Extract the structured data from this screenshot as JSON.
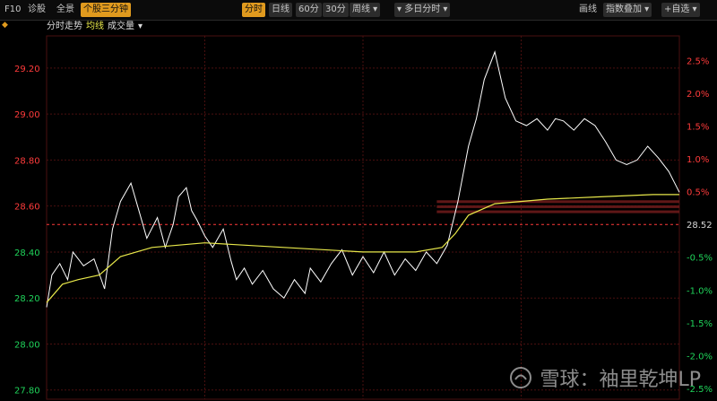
{
  "toolbar": {
    "left_items": [
      "F10",
      "诊股",
      "全景",
      "个股三分钟"
    ],
    "period_tabs": [
      "分时",
      "日线",
      "60分",
      "30分",
      "周线 ▾"
    ],
    "multiday": "▾ 多日分时 ▾",
    "right_items": [
      "画线",
      "指数叠加 ▾",
      "+自选 ▾"
    ]
  },
  "subbar": {
    "label1": "分时走势",
    "label2": "均线",
    "label3": "成交量",
    "caret": "▾"
  },
  "colors": {
    "price_line": "#ffffff",
    "avg_line": "#e8e84a",
    "up": "#ff3b3b",
    "down": "#1fd35a",
    "ref": "#d8d8d8",
    "grid": "#4a0f0f",
    "accent": "#e09a1e"
  },
  "chart_data": {
    "type": "line",
    "title": "",
    "xlabel": "",
    "ylabel": "",
    "ylim": [
      27.76,
      29.34
    ],
    "prev_close": 28.52,
    "left_ticks": [
      "29.20",
      "29.00",
      "28.80",
      "28.60",
      "28.40",
      "28.20",
      "28.00",
      "27.80"
    ],
    "right_ticks": [
      "2.5%",
      "2.0%",
      "1.5%",
      "1.0%",
      "0.5%",
      "-0.5%",
      "-1.0%",
      "-1.5%",
      "-2.0%",
      "-2.5%"
    ],
    "prev_close_label": "28.52",
    "grid": true,
    "series": [
      {
        "x": [
          0,
          2,
          5,
          8,
          10,
          14,
          18,
          22,
          25,
          28,
          32,
          35,
          38,
          42,
          45,
          48,
          50,
          53,
          55,
          57,
          60,
          63,
          65,
          67,
          70,
          72,
          75,
          78,
          82,
          86,
          90,
          94,
          98,
          100,
          104,
          108,
          112,
          116,
          120,
          124,
          128,
          132,
          136,
          140,
          144,
          148,
          152,
          156,
          160,
          163,
          166,
          170,
          174,
          178,
          182,
          186,
          190,
          193,
          196,
          200,
          204,
          208,
          212,
          216,
          220,
          224,
          228,
          232,
          236,
          240
        ],
        "values": [
          28.16,
          28.3,
          28.35,
          28.28,
          28.4,
          28.34,
          28.37,
          28.24,
          28.5,
          28.62,
          28.7,
          28.58,
          28.46,
          28.55,
          28.42,
          28.52,
          28.64,
          28.68,
          28.58,
          28.54,
          28.47,
          28.42,
          28.46,
          28.5,
          28.36,
          28.28,
          28.33,
          28.26,
          28.32,
          28.24,
          28.2,
          28.28,
          28.22,
          28.33,
          28.27,
          28.35,
          28.41,
          28.3,
          28.38,
          28.31,
          28.4,
          28.3,
          28.37,
          28.32,
          28.4,
          28.35,
          28.43,
          28.62,
          28.86,
          28.98,
          29.15,
          29.27,
          29.07,
          28.97,
          28.95,
          28.98,
          28.93,
          28.98,
          28.97,
          28.93,
          28.98,
          28.95,
          28.88,
          28.8,
          28.78,
          28.8,
          28.86,
          28.81,
          28.75,
          28.66
        ]
      },
      {
        "x": [
          0,
          6,
          12,
          20,
          28,
          40,
          60,
          90,
          120,
          140,
          150,
          155,
          160,
          170,
          190,
          210,
          230,
          240
        ],
        "values": [
          28.18,
          28.26,
          28.28,
          28.3,
          28.38,
          28.42,
          28.44,
          28.42,
          28.4,
          28.4,
          28.42,
          28.48,
          28.56,
          28.61,
          28.63,
          28.64,
          28.65,
          28.65
        ]
      }
    ]
  },
  "watermark": {
    "text": "雪球：袖里乾坤LP"
  }
}
